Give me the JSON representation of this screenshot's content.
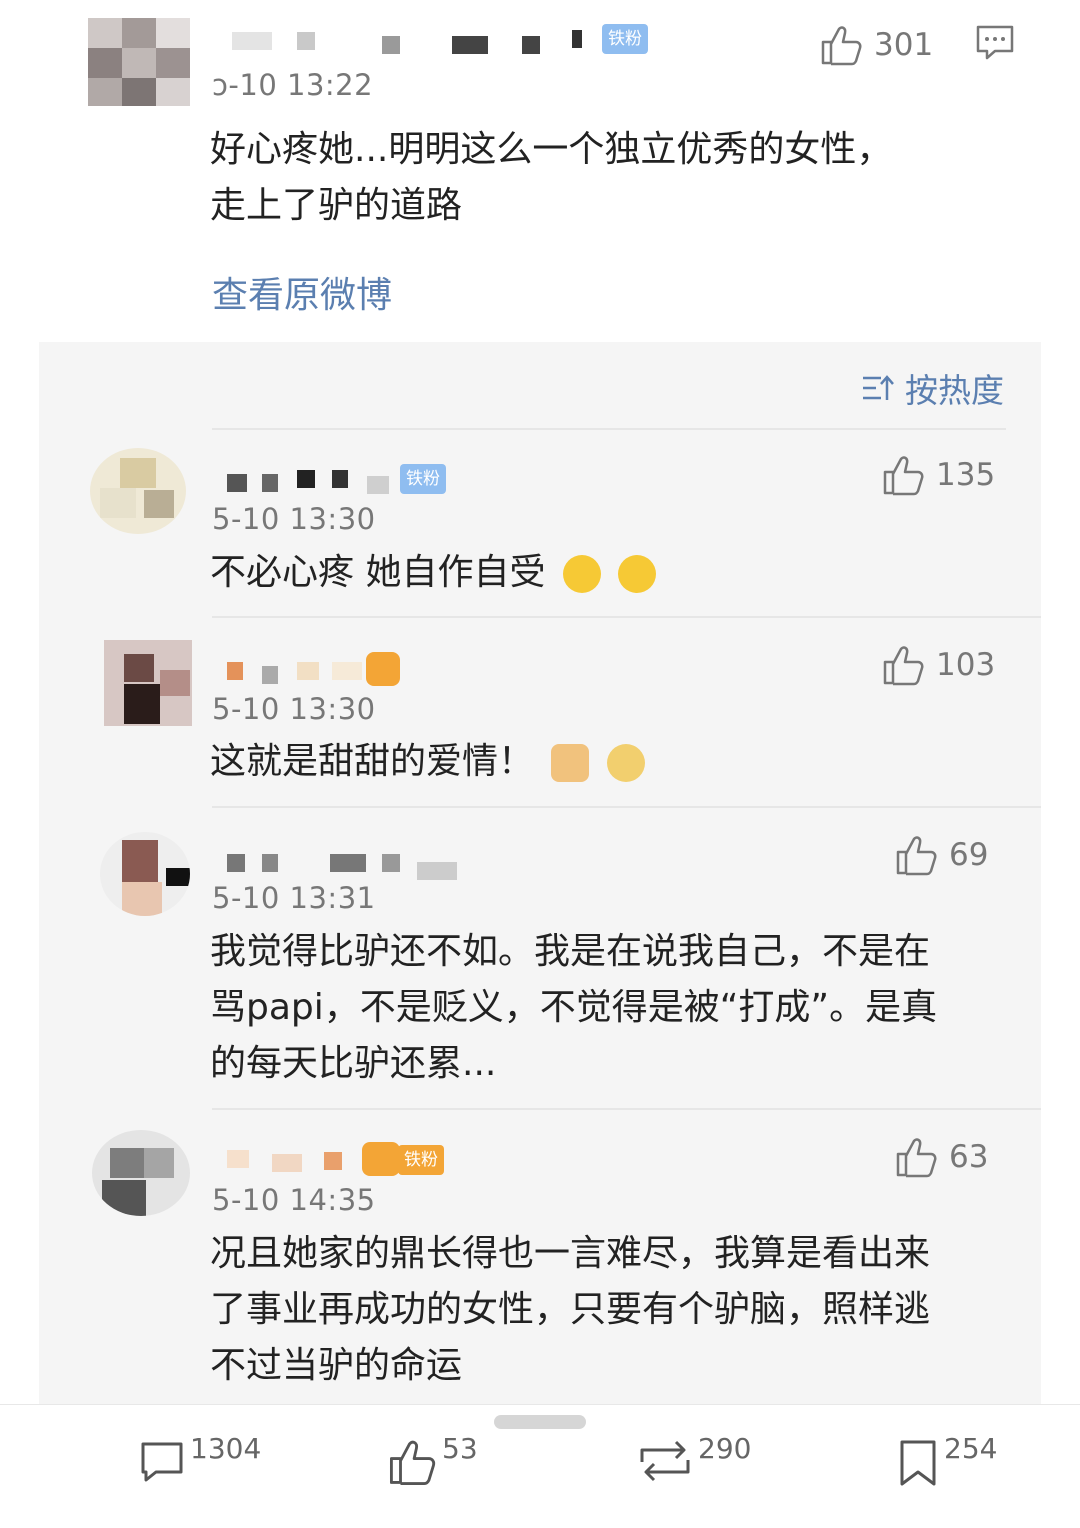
{
  "post": {
    "time": "ɔ-10 13:22",
    "badge": "铁粉",
    "like_count": "301",
    "content_line1": "好心疼她...明明这么一个独立优秀的女性，",
    "content_line2": "走上了驴的道路",
    "view_original": "查看原微博"
  },
  "sort": {
    "label": "按热度"
  },
  "comments": [
    {
      "time": "5-10 13:30",
      "badge": "铁粉",
      "likes": "135",
      "lines": [
        "不必心疼 她自作自受"
      ]
    },
    {
      "time": "5-10 13:30",
      "likes": "103",
      "lines": [
        "这就是甜甜的爱情！"
      ]
    },
    {
      "time": "5-10 13:31",
      "likes": "69",
      "lines": [
        "我觉得比驴还不如。我是在说我自己，不是在",
        "骂papi，不是贬义，不觉得是被“打成”。是真",
        "的每天比驴还累..."
      ]
    },
    {
      "time": "5-10 14:35",
      "badge": "铁粉",
      "likes": "63",
      "lines": [
        "况且她家的鼎长得也一言难尽，我算是看出来",
        "了事业再成功的女性，只要有个驴脑，照样逃",
        "不过当驴的命运"
      ]
    }
  ],
  "bottom_bar": {
    "comments": "1304",
    "likes": "53",
    "reposts": "290",
    "favorites": "254"
  },
  "colors": {
    "link": "#5b7fb0",
    "badge": "#8fbdf0",
    "panel": "#f5f5f5"
  }
}
